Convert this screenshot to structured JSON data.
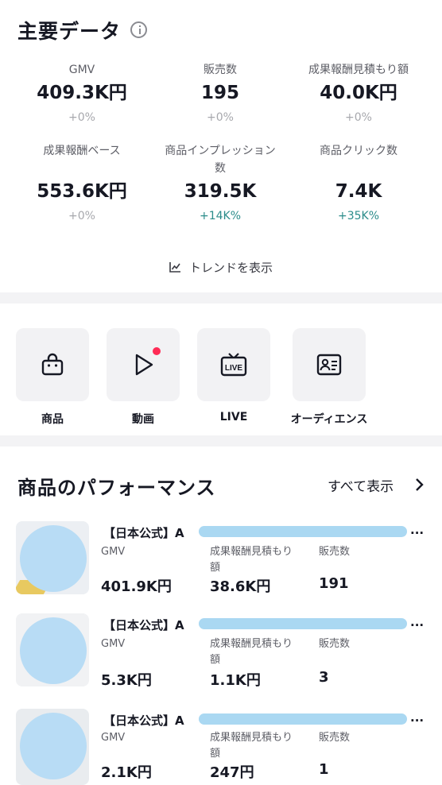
{
  "key_data": {
    "title": "主要データ",
    "metrics": [
      {
        "label": "GMV",
        "value": "409.3K円",
        "delta": "+0%"
      },
      {
        "label": "販売数",
        "value": "195",
        "delta": "+0%"
      },
      {
        "label": "成果報酬見積もり額",
        "value": "40.0K円",
        "delta": "+0%"
      },
      {
        "label": "成果報酬ベース",
        "value": "553.6K円",
        "delta": "+0%"
      },
      {
        "label_line1": "商品インプレッション",
        "label_line2": "数",
        "value": "319.5K",
        "delta": "+14K%"
      },
      {
        "label": "商品クリック数",
        "value": "7.4K",
        "delta": "+35K%"
      }
    ],
    "trend_label": "トレンドを表示"
  },
  "shortcuts": [
    {
      "label": "商品",
      "icon": "shopping-bag-icon"
    },
    {
      "label": "動画",
      "icon": "play-icon"
    },
    {
      "label": "LIVE",
      "icon": "live-tv-icon"
    },
    {
      "label": "オーディエンス",
      "icon": "id-card-icon"
    }
  ],
  "performance": {
    "title": "商品のパフォーマンス",
    "see_all": "すべて表示",
    "col_gmv": "GMV",
    "col_commission_line1": "成果報酬見積もり",
    "col_commission_line2": "額",
    "col_sales": "販売数",
    "products": [
      {
        "name_prefix": "【日本公式】A",
        "more": "...",
        "gmv": "401.9K円",
        "commission": "38.6K円",
        "sales": "191"
      },
      {
        "name_prefix": "【日本公式】A",
        "more": "...",
        "gmv": "5.3K円",
        "commission": "1.1K円",
        "sales": "3"
      },
      {
        "name_prefix": "【日本公式】A",
        "more": "...",
        "gmv": "2.1K円",
        "commission": "247円",
        "sales": "1"
      }
    ]
  },
  "colors": {
    "positive_delta": "#2b8c8a",
    "live_badge_dot": "#ff2b55",
    "redaction": "#aad8f2"
  }
}
